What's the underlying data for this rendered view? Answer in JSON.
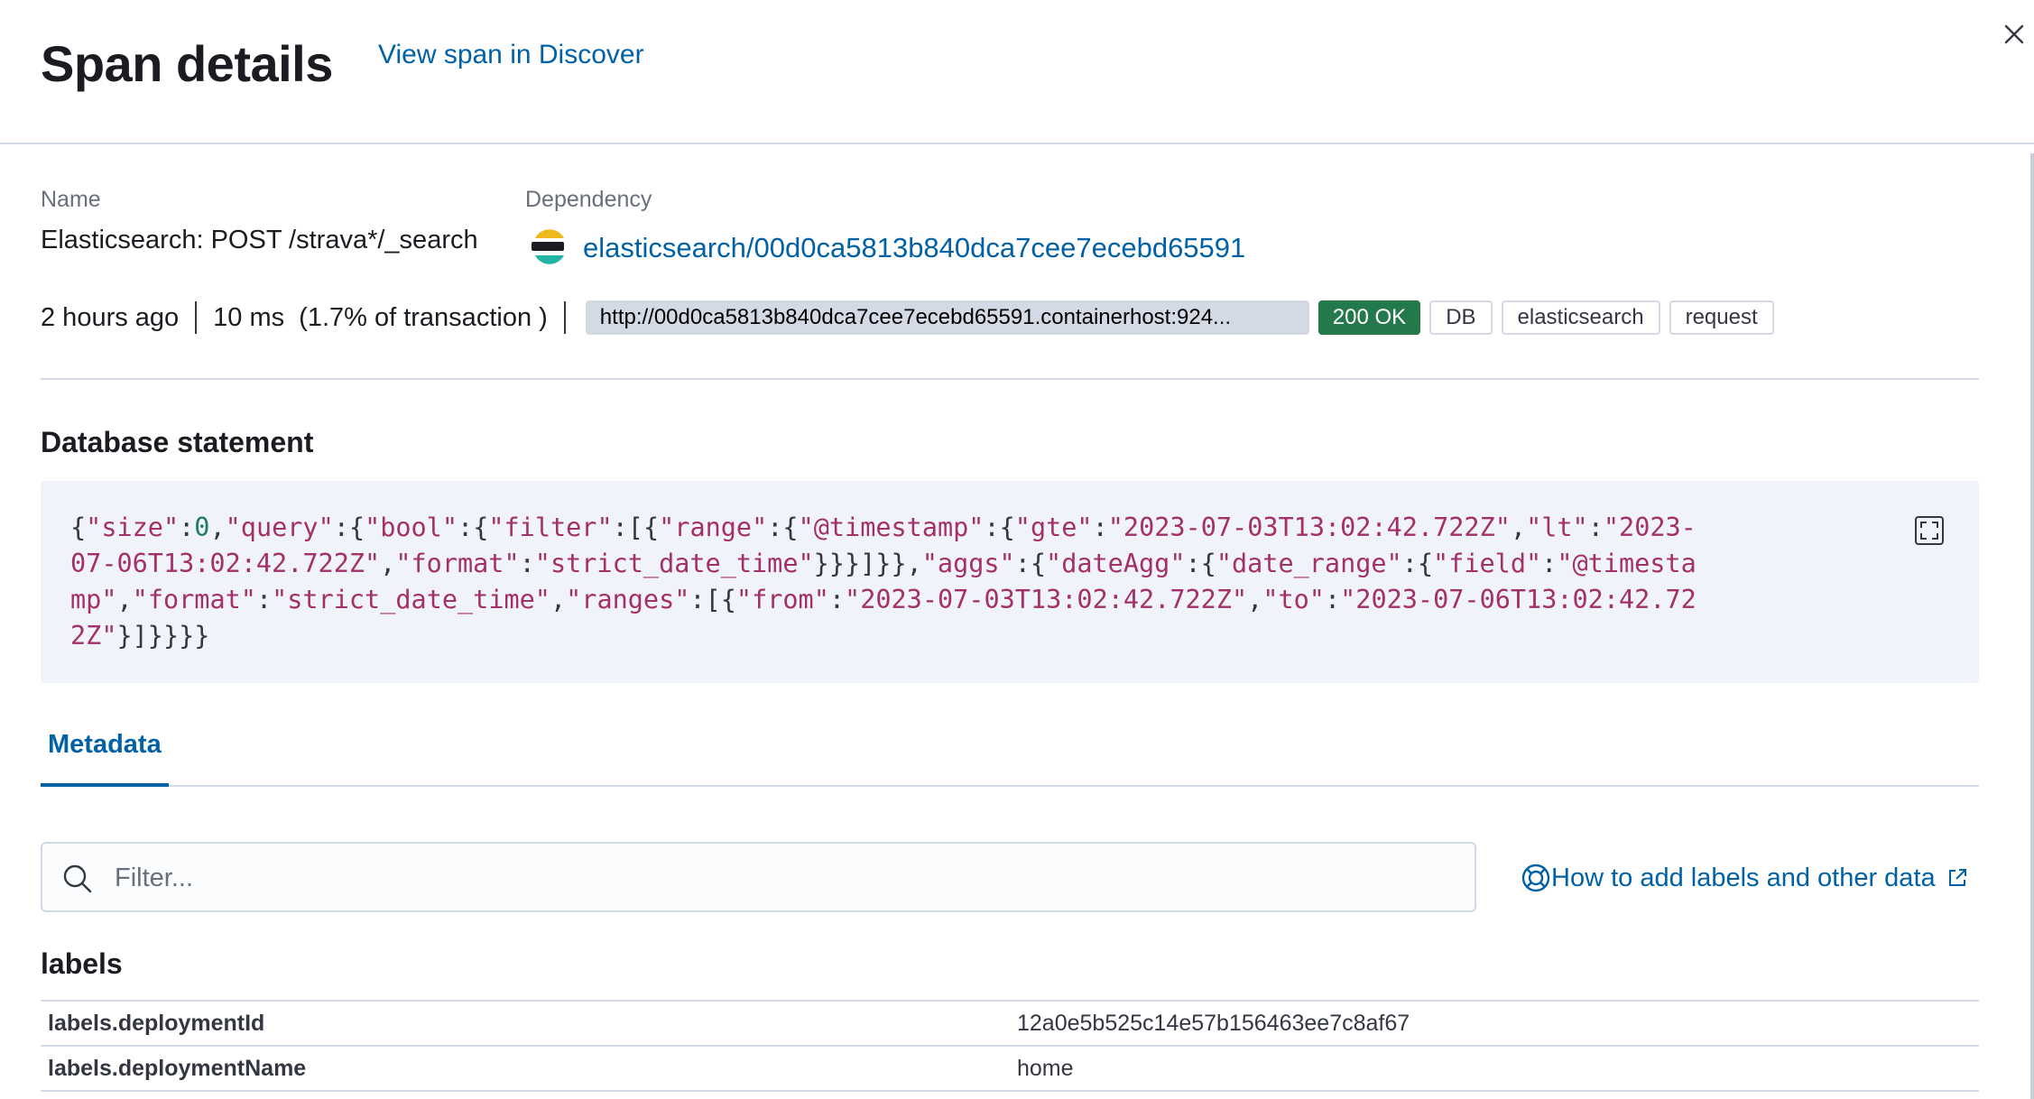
{
  "header": {
    "title": "Span details",
    "discover_link": "View span in Discover"
  },
  "span": {
    "name_label": "Name",
    "name": "Elasticsearch: POST /strava*/_search",
    "dependency_label": "Dependency",
    "dependency": "elasticsearch/00d0ca5813b840dca7cee7ecebd65591",
    "dependency_icon": "elasticsearch-logo-icon"
  },
  "summary": {
    "timestamp": "2 hours ago",
    "duration": "10 ms",
    "percent": "(1.7% of transaction )",
    "url": "http://00d0ca5813b840dca7cee7ecebd65591.containerhost:924...",
    "status": "200 OK",
    "badges": [
      "DB",
      "elasticsearch",
      "request"
    ]
  },
  "database_statement": {
    "title": "Database statement",
    "statement": "{\"size\":0,\"query\":{\"bool\":{\"filter\":[{\"range\":{\"@timestamp\":{\"gte\":\"2023-07-03T13:02:42.722Z\",\"lt\":\"2023-07-06T13:02:42.722Z\",\"format\":\"strict_date_time\"}}}]}},\"aggs\":{\"dateAgg\":{\"date_range\":{\"field\":\"@timestamp\",\"format\":\"strict_date_time\",\"ranges\":[{\"from\":\"2023-07-03T13:02:42.722Z\",\"to\":\"2023-07-06T13:02:42.722Z\"}]}}}}"
  },
  "tabs": [
    {
      "label": "Metadata",
      "selected": true
    }
  ],
  "metadata": {
    "filter_placeholder": "Filter...",
    "help_link": "How to add labels and other data",
    "section_title": "labels",
    "rows": [
      {
        "key": "labels.deploymentId",
        "value": "12a0e5b525c14e57b156463ee7c8af67"
      },
      {
        "key": "labels.deploymentName",
        "value": "home"
      }
    ]
  },
  "colors": {
    "link": "#0061a6",
    "status_ok": "#24794a",
    "code_background": "#f0f3f9",
    "code_string": "#a4306a",
    "code_number": "#1e7d5e",
    "border": "#d3dae6"
  }
}
